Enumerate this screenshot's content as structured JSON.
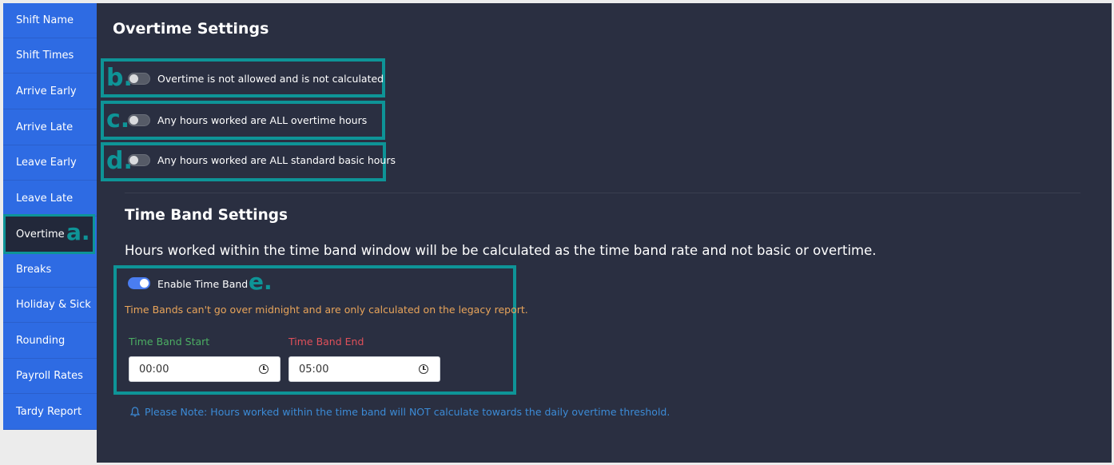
{
  "sidebar": {
    "items": [
      {
        "label": "Shift Name"
      },
      {
        "label": "Shift Times"
      },
      {
        "label": "Arrive Early"
      },
      {
        "label": "Arrive Late"
      },
      {
        "label": "Leave Early"
      },
      {
        "label": "Leave Late"
      },
      {
        "label": "Overtime"
      },
      {
        "label": "Breaks"
      },
      {
        "label": "Holiday & Sick"
      },
      {
        "label": "Rounding"
      },
      {
        "label": "Payroll Rates"
      },
      {
        "label": "Tardy Report"
      }
    ],
    "active_index": 6
  },
  "callouts": {
    "a": "a.",
    "b": "b.",
    "c": "c.",
    "d": "d.",
    "e": "e."
  },
  "overtime": {
    "title": "Overtime Settings",
    "options": [
      {
        "label": "Overtime is not allowed and is not calculated",
        "on": false
      },
      {
        "label": "Any hours worked are ALL overtime hours",
        "on": false
      },
      {
        "label": "Any hours worked are ALL standard basic hours",
        "on": false
      }
    ]
  },
  "time_band": {
    "title": "Time Band Settings",
    "description": "Hours worked within the time band window will be be calculated as the time band rate and not basic or overtime.",
    "enable_label": "Enable Time Band",
    "enabled": true,
    "warning": "Time Bands can't go over midnight and are only calculated on the legacy report.",
    "start_label": "Time Band Start",
    "start_value": "00:00",
    "end_label": "Time Band End",
    "end_value": "05:00",
    "note": "Please Note: Hours worked within the time band will NOT calculate towards the daily overtime threshold."
  },
  "colors": {
    "accent": "#0e9497",
    "sidebar": "#2e6be3",
    "panel": "#2a2f41",
    "warning": "#e8a45a",
    "start": "#4cae63",
    "end": "#e0505a",
    "note": "#3c8bd6"
  }
}
